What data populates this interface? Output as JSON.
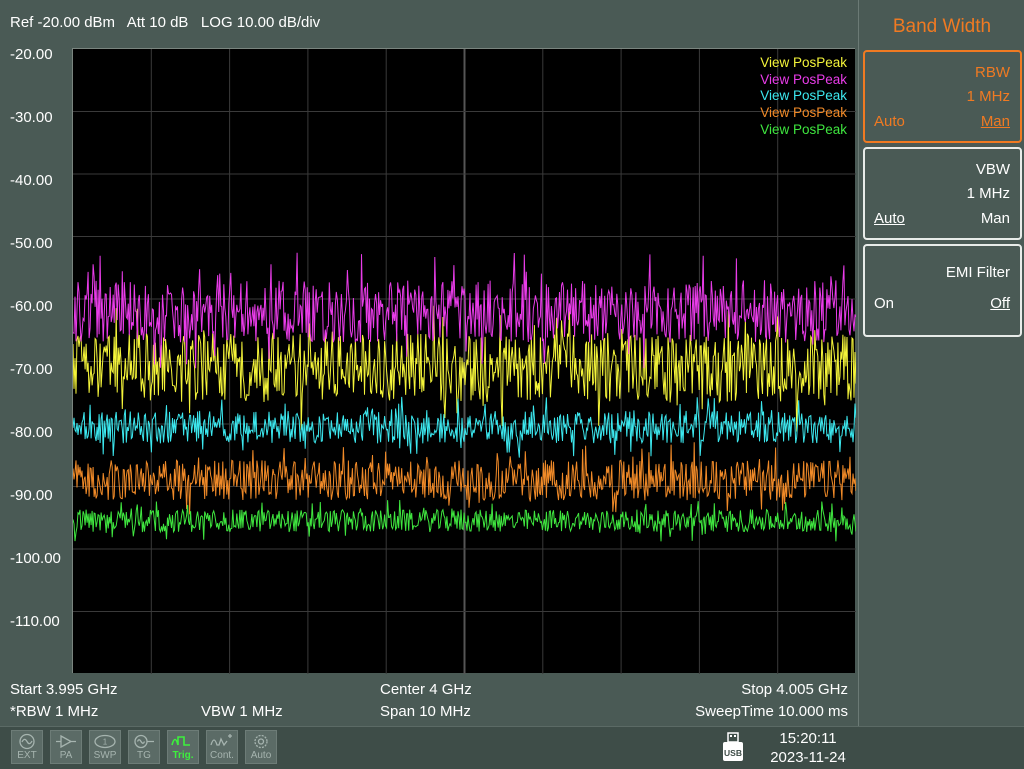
{
  "header": {
    "status_line": "Ref -20.00 dBm   Att 10 dB   LOG 10.00 dB/div"
  },
  "yaxis": {
    "labels": [
      "-20.00",
      "-30.00",
      "-40.00",
      "-50.00",
      "-60.00",
      "-70.00",
      "-80.00",
      "-90.00",
      "-100.00",
      "-110.00"
    ]
  },
  "legend": [
    {
      "label": "View PosPeak",
      "color": "#f4f43a"
    },
    {
      "label": "View PosPeak",
      "color": "#e93ce9"
    },
    {
      "label": "View PosPeak",
      "color": "#3ce8ef"
    },
    {
      "label": "View PosPeak",
      "color": "#f08a28"
    },
    {
      "label": "View PosPeak",
      "color": "#3fe63f"
    }
  ],
  "bottom": {
    "start": "Start 3.995 GHz",
    "center": "Center 4 GHz",
    "stop": "Stop 4.005 GHz",
    "rbw": "*RBW 1 MHz",
    "vbw": "VBW 1 MHz",
    "span": "Span 10 MHz",
    "sweep": "SweepTime 10.000 ms"
  },
  "statusbar": {
    "buttons": [
      {
        "name": "ext",
        "label": "EXT"
      },
      {
        "name": "pa",
        "label": "PA"
      },
      {
        "name": "swp",
        "label": "SWP"
      },
      {
        "name": "tg",
        "label": "TG"
      },
      {
        "name": "trig",
        "label": "Trig."
      },
      {
        "name": "cont",
        "label": "Cont."
      },
      {
        "name": "auto",
        "label": "Auto"
      }
    ],
    "usb_label": "USB",
    "time": "15:20:11",
    "date": "2023-11-24"
  },
  "panel": {
    "title": "Band Width",
    "rbw": {
      "name": "RBW",
      "value": "1 MHz",
      "left": "Auto",
      "right": "Man"
    },
    "vbw": {
      "name": "VBW",
      "value": "1 MHz",
      "left": "Auto",
      "right": "Man"
    },
    "emi": {
      "name": "EMI Filter",
      "left": "On",
      "right": "Off"
    }
  },
  "colors": {
    "accent": "#f07a22",
    "background": "#4a5a55",
    "plot_bg": "#000000",
    "grid": "#3a3a3a"
  },
  "chart_data": {
    "type": "line",
    "xlabel": "",
    "ylabel": "",
    "xlim": [
      3.995,
      4.005
    ],
    "ylim": [
      -120,
      -20
    ],
    "x_unit": "GHz",
    "y_unit": "dBm",
    "grid": true,
    "legend_position": "top-right",
    "series": [
      {
        "name": "View PosPeak",
        "color": "#f4f43a",
        "mean": -71,
        "spread": 5.5
      },
      {
        "name": "View PosPeak",
        "color": "#e93ce9",
        "mean": -62,
        "spread": 5
      },
      {
        "name": "View PosPeak",
        "color": "#3ce8ef",
        "mean": -80.5,
        "spread": 2.6
      },
      {
        "name": "View PosPeak",
        "color": "#f08a28",
        "mean": -89,
        "spread": 3.2
      },
      {
        "name": "View PosPeak",
        "color": "#3fe63f",
        "mean": -95.5,
        "spread": 1.8
      }
    ]
  }
}
